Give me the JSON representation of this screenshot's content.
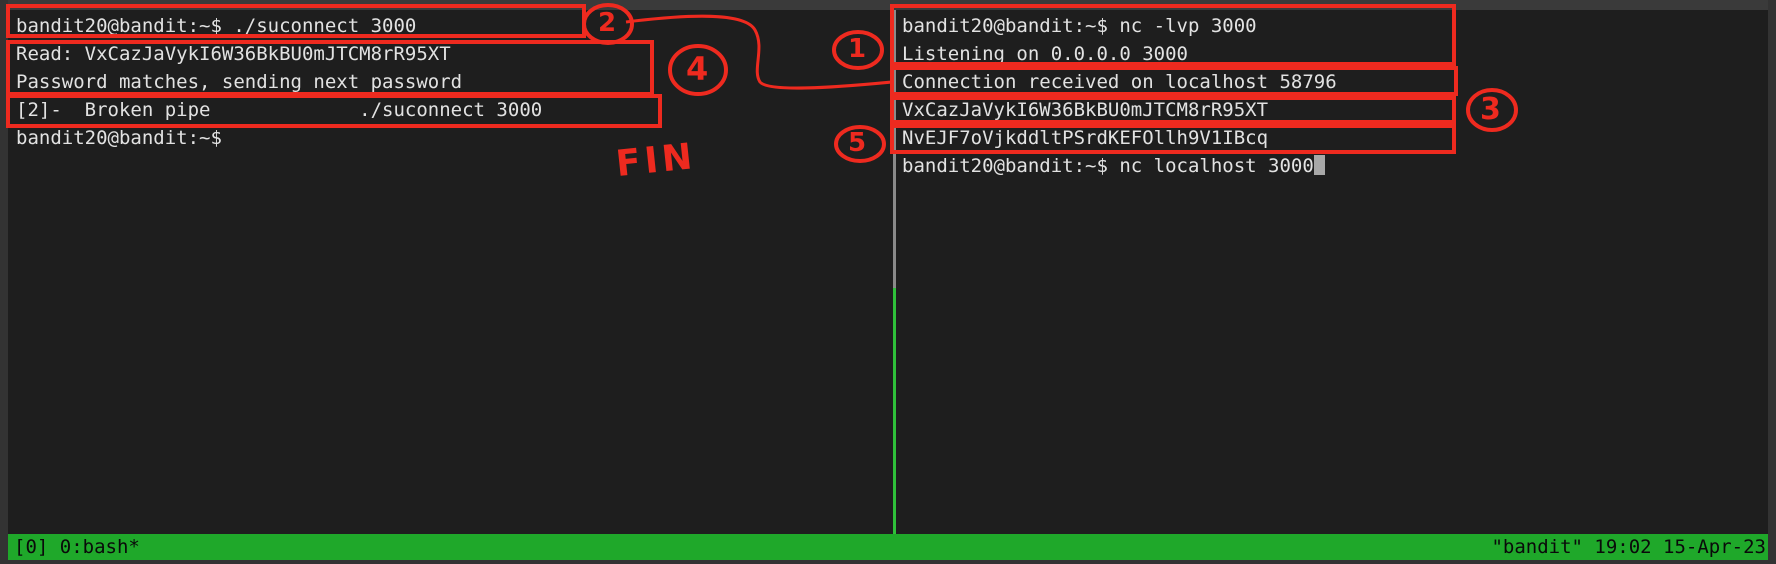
{
  "left_pane": {
    "lines": [
      "bandit20@bandit:~$ ./suconnect 3000",
      "Read: VxCazJaVykI6W36BkBU0mJTCM8rR95XT",
      "Password matches, sending next password",
      "[2]-  Broken pipe             ./suconnect 3000",
      "bandit20@bandit:~$"
    ]
  },
  "right_pane": {
    "lines": [
      "bandit20@bandit:~$ nc -lvp 3000",
      "Listening on 0.0.0.0 3000",
      "Connection received on localhost 58796",
      "VxCazJaVykI6W36BkBU0mJTCM8rR95XT",
      "NvEJF7oVjkddltPSrdKEFOllh9V1IBcq",
      "bandit20@bandit:~$ nc localhost 3000"
    ]
  },
  "status_bar": {
    "left": "[0] 0:bash*",
    "right": "\"bandit\" 19:02 15-Apr-23"
  },
  "annotations": {
    "step_1": "1",
    "step_2": "2",
    "step_3": "3",
    "step_4": "4",
    "step_5": "5",
    "fin": "FIN"
  },
  "colors": {
    "terminal_bg": "#1e1e1e",
    "terminal_text": "#e2e2e2",
    "status_bar_bg": "#1fa82a",
    "annotation_red": "#ee2a1f",
    "active_pane_border": "#2fc13a"
  }
}
